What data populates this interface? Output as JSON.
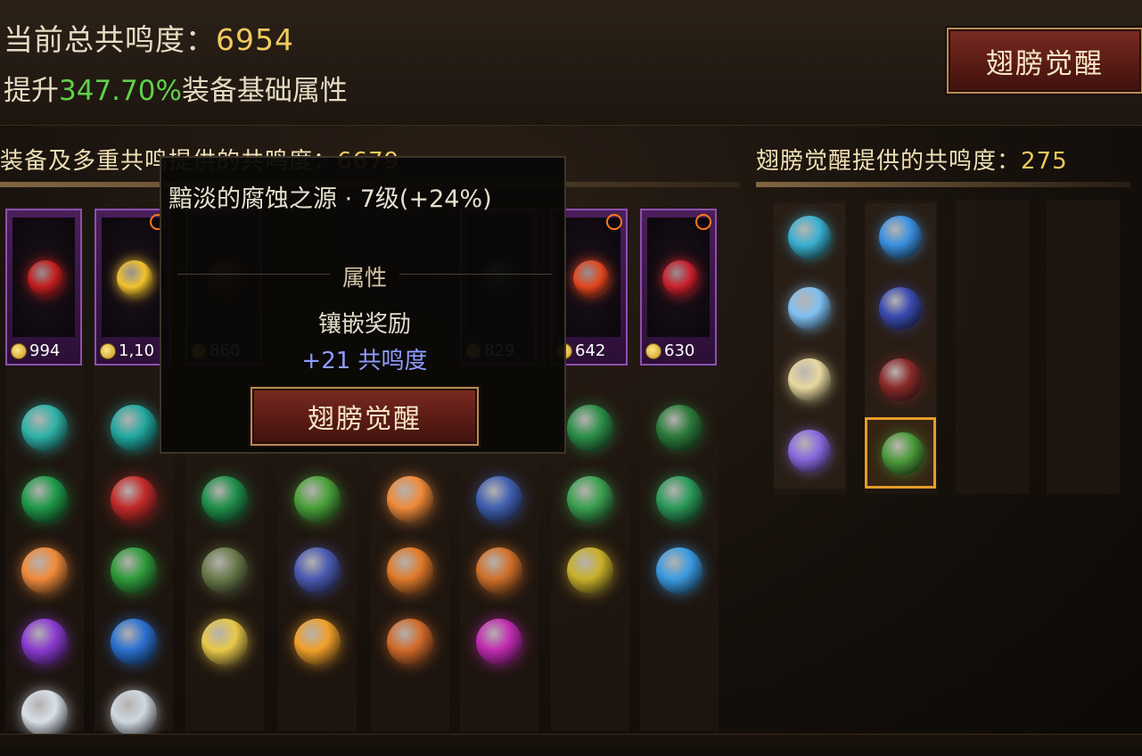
{
  "header": {
    "total_label": "当前总共鸣度：",
    "total_value": "6954",
    "boost_prefix": "提升",
    "boost_pct": "347.70%",
    "boost_suffix": "装备基础属性",
    "awaken_button": "翅膀觉醒"
  },
  "equip_section": {
    "title_label": "装备及多重共鸣提供的共鸣度：",
    "title_value": "6679"
  },
  "wing_section": {
    "title_label": "翅膀觉醒提供的共鸣度：",
    "title_value": "275"
  },
  "cards": [
    {
      "price": "994",
      "badge": false,
      "gem_color": "#c21e1e"
    },
    {
      "price": "1,10",
      "badge": true,
      "gem_color": "#f2c22e"
    },
    {
      "price": "860",
      "badge": false,
      "gem_color": "#7a4a20"
    },
    {
      "price": "829",
      "badge": false,
      "gem_color": "#3a3a70"
    },
    {
      "price": "642",
      "badge": true,
      "gem_color": "#e2461e"
    },
    {
      "price": "630",
      "badge": true,
      "gem_color": "#c8202c"
    }
  ],
  "tooltip": {
    "title": "黯淡的腐蚀之源 · 7级(+24%)",
    "attr_heading": "属性",
    "reward_label": "镶嵌奖励",
    "reward_value": "+21 共鸣度",
    "button": "翅膀觉醒"
  },
  "gem_grid_colors": [
    [
      "#2fb3a8",
      "#22a8a0",
      null,
      null,
      null,
      null,
      "#2c8f4a",
      "#2b7a3a"
    ],
    [
      "#1f9a4a",
      "#c22a2a",
      "#1f8f4a",
      "#4aa03a",
      "#f08a3a",
      "#4060b0",
      "#3aa050",
      "#2a9a5a"
    ],
    [
      "#f08a3a",
      "#2f9a3a",
      "#6a7a4a",
      "#4a5ab0",
      "#e07a2a",
      "#d0702a",
      "#c8b02a",
      "#3a9ae0"
    ],
    [
      "#8a3ad0",
      "#2a70d0",
      "#e8c84a",
      "#f0a02a",
      "#d06a2a",
      "#c02ab0",
      null,
      null
    ],
    [
      "#d8e0e8",
      "#d0d8e0",
      null,
      null,
      null,
      null,
      null,
      null
    ]
  ],
  "wing_gems": [
    [
      "#3ab0d0",
      "#3a90e0"
    ],
    [
      "#80c0f0",
      "#3a4ab0"
    ],
    [
      "#e8d8a0",
      "#8a2a2a"
    ],
    [
      "#8a6ae0",
      "#4a9a3a"
    ]
  ]
}
